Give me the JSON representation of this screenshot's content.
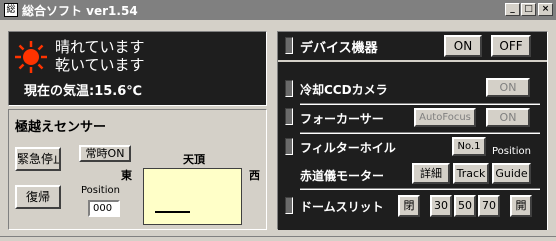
{
  "window": {
    "title": "総合ソフト ver1.54",
    "minimize": "_",
    "maximize": "□",
    "close": "×"
  },
  "weather": {
    "line1": "晴れています",
    "line2": "乾いています",
    "temperature": "現在の気温:15.6℃"
  },
  "sensor": {
    "title": "極越えセンサー",
    "emergency_stop": "緊急停止",
    "always_on": "常時ON",
    "restore": "復帰",
    "position_label": "Position",
    "position_value": "000",
    "east": "東",
    "west": "西",
    "zenith": "天頂"
  },
  "devices": {
    "title": "デバイス機器",
    "on": "ON",
    "off": "OFF",
    "ccd": {
      "label": "冷却CCDカメラ",
      "button": "ON"
    },
    "focuser": {
      "label": "フォーカーサー",
      "autofocus": "AutoFocus",
      "button": "ON"
    },
    "filter": {
      "label": "フィルターホイル",
      "value": "No.1",
      "position_label": "Position"
    },
    "equatorial": {
      "label": "赤道儀モーター",
      "detail": "詳細",
      "track": "Track",
      "guide": "Guide"
    },
    "dome": {
      "label": "ドームスリット",
      "close": "閉",
      "b30": "30",
      "b50": "50",
      "b70": "70",
      "open": "開"
    }
  },
  "colors": {
    "panel_dark": "#1e1e1e",
    "sun": "#ff3300",
    "sky_box": "#ffffc8"
  }
}
